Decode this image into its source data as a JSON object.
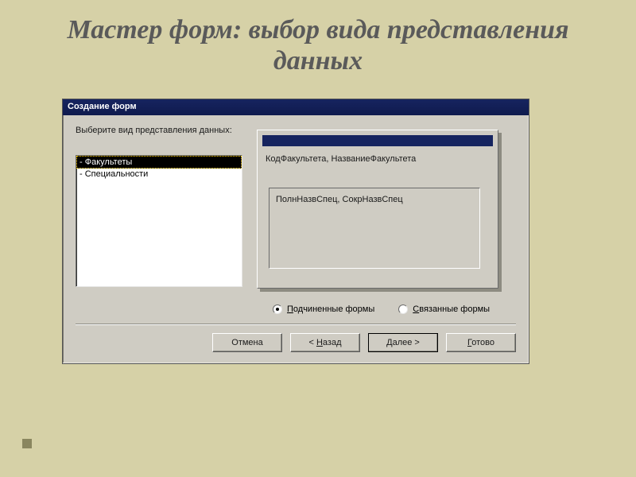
{
  "slide": {
    "title": "Мастер форм: выбор вида представления данных"
  },
  "dialog": {
    "title": "Создание форм",
    "prompt": "Выберите вид представления данных:",
    "list": {
      "items": [
        "- Факультеты",
        "- Специальности"
      ],
      "selected_index": 0
    },
    "preview": {
      "master_fields": "КодФакультета, НазваниеФакультета",
      "sub_fields": "ПолнНазвСпец, СокрНазвСпец"
    },
    "radios": {
      "sub_label_pre": "П",
      "sub_label_rest": "одчиненные формы",
      "linked_label_pre": "С",
      "linked_label_rest": "вязанные формы",
      "selected": "sub"
    },
    "buttons": {
      "cancel": "Отмена",
      "back_pre": "< ",
      "back_u": "Н",
      "back_rest": "азад",
      "next_pre": "",
      "next_u": "Д",
      "next_rest": "алее >",
      "finish_pre": "",
      "finish_u": "Г",
      "finish_rest": "отово"
    }
  }
}
